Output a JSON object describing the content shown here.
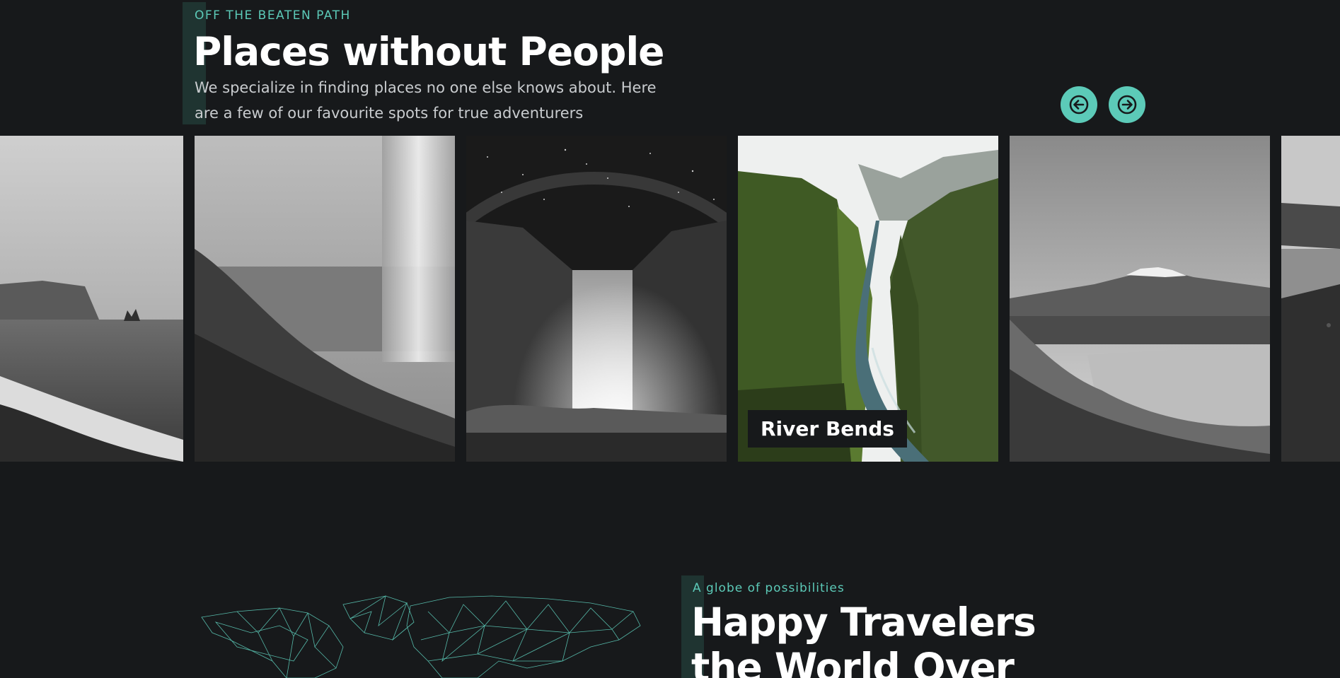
{
  "places_section": {
    "eyebrow": "OFF THE BEATEN PATH",
    "title": "Places without People",
    "description_line1": "We specialize in finding places no one else knows about. Here",
    "description_line2": "are a few of our favourite spots for true adventurers",
    "accent_color": "#5ccab8",
    "prev_icon": "arrow-left-circle-icon",
    "next_icon": "arrow-right-circle-icon"
  },
  "gallery": {
    "cards": [
      {
        "name": "beach-stacks",
        "label": ""
      },
      {
        "name": "waterfall-cliff",
        "label": ""
      },
      {
        "name": "night-waterfall",
        "label": ""
      },
      {
        "name": "green-canyon",
        "label": "River Bends"
      },
      {
        "name": "mountain-lake",
        "label": ""
      },
      {
        "name": "coast-cliffs",
        "label": ""
      }
    ]
  },
  "travelers_section": {
    "eyebrow": "A globe of possibilities",
    "title_line1": "Happy Travelers",
    "title_line2": "the World Over"
  },
  "colors": {
    "background": "#17191b",
    "accent": "#5ccab8",
    "accent_bar": "#1f3431"
  }
}
